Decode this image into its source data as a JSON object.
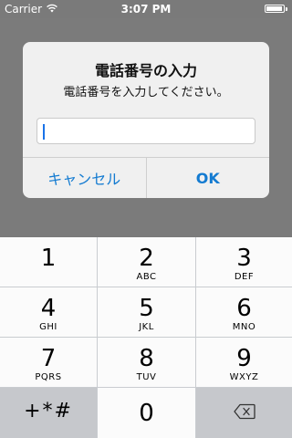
{
  "status_bar": {
    "carrier": "Carrier",
    "time": "3:07 PM",
    "battery_level": 0.95
  },
  "alert": {
    "title": "電話番号の入力",
    "message": "電話番号を入力してください。",
    "input_value": "",
    "cancel_label": "キャンセル",
    "ok_label": "OK",
    "accent_color": "#147bd1"
  },
  "keypad": {
    "keys": [
      {
        "digit": "1",
        "letters": ""
      },
      {
        "digit": "2",
        "letters": "ABC"
      },
      {
        "digit": "3",
        "letters": "DEF"
      },
      {
        "digit": "4",
        "letters": "GHI"
      },
      {
        "digit": "5",
        "letters": "JKL"
      },
      {
        "digit": "6",
        "letters": "MNO"
      },
      {
        "digit": "7",
        "letters": "PQRS"
      },
      {
        "digit": "8",
        "letters": "TUV"
      },
      {
        "digit": "9",
        "letters": "WXYZ"
      }
    ],
    "symbols_label": "+*#",
    "zero": "0",
    "backspace_icon": "delete-left-icon"
  }
}
